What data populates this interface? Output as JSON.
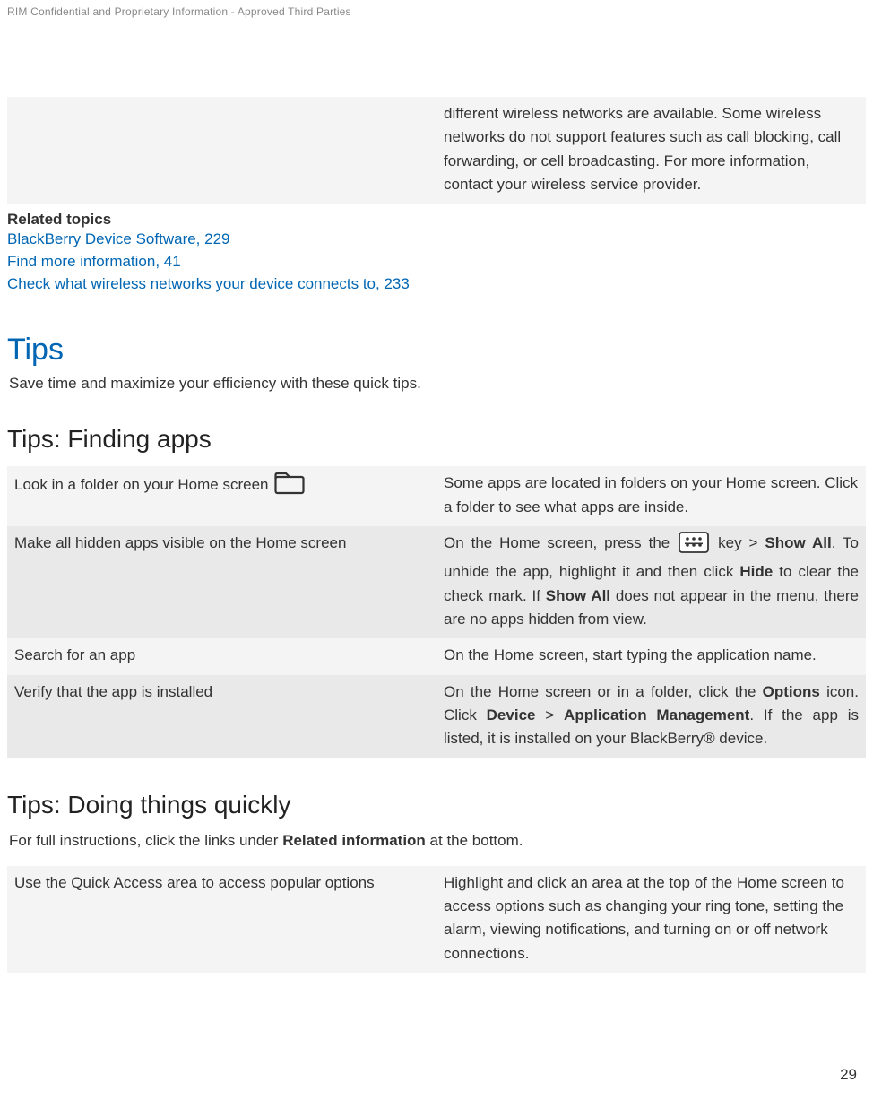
{
  "header": {
    "confidential": "RIM Confidential and Proprietary Information - Approved Third Parties"
  },
  "top_row": {
    "desc": "different wireless networks are available. Some wireless networks do not support features such as call blocking, call forwarding, or cell broadcasting. For more information, contact your wireless service provider."
  },
  "related": {
    "heading": "Related topics",
    "links": [
      "BlackBerry Device Software, 229",
      "Find more information, 41",
      "Check what wireless networks your device connects to, 233"
    ]
  },
  "tips": {
    "title": "Tips",
    "intro": "Save time and maximize your efficiency with these quick tips."
  },
  "finding_apps": {
    "title": "Tips: Finding apps",
    "rows": [
      {
        "label": "Look in a folder on your Home screen",
        "desc": "Some apps are located in folders on your Home screen. Click a folder to see what apps are inside."
      },
      {
        "label": "Make all hidden apps visible on the Home screen",
        "desc_pre_key": "On the Home screen, press the",
        "desc_post_key_1": "key >",
        "bold_1": "Show All",
        "desc_mid_1": ". To unhide the app, highlight it and then click",
        "bold_2": "Hide",
        "desc_mid_2": "to clear the check mark. If",
        "bold_3": "Show All",
        "desc_end": "does not appear in the menu, there are no apps hidden from view."
      },
      {
        "label": "Search for an app",
        "desc": "On the Home screen, start typing the application name."
      },
      {
        "label": "Verify that the app is installed",
        "desc_pre": "On the Home screen or in a folder, click the",
        "bold_1": "Options",
        "desc_mid_1": "icon. Click",
        "bold_2": "Device",
        "desc_mid_2": ">",
        "bold_3": "Application Management",
        "desc_end": ". If the app is listed, it is installed on your BlackBerry® device."
      }
    ]
  },
  "doing_quickly": {
    "title": "Tips: Doing things quickly",
    "intro_pre": "For full instructions, click the links under",
    "intro_bold": "Related information",
    "intro_post": "at the bottom.",
    "rows": [
      {
        "label": "Use the Quick Access area to access popular options",
        "desc": "Highlight and click an area at the top of the Home screen to access options such as changing your ring tone, setting the alarm, viewing notifications, and turning on or off network connections."
      }
    ]
  },
  "page_number": "29"
}
